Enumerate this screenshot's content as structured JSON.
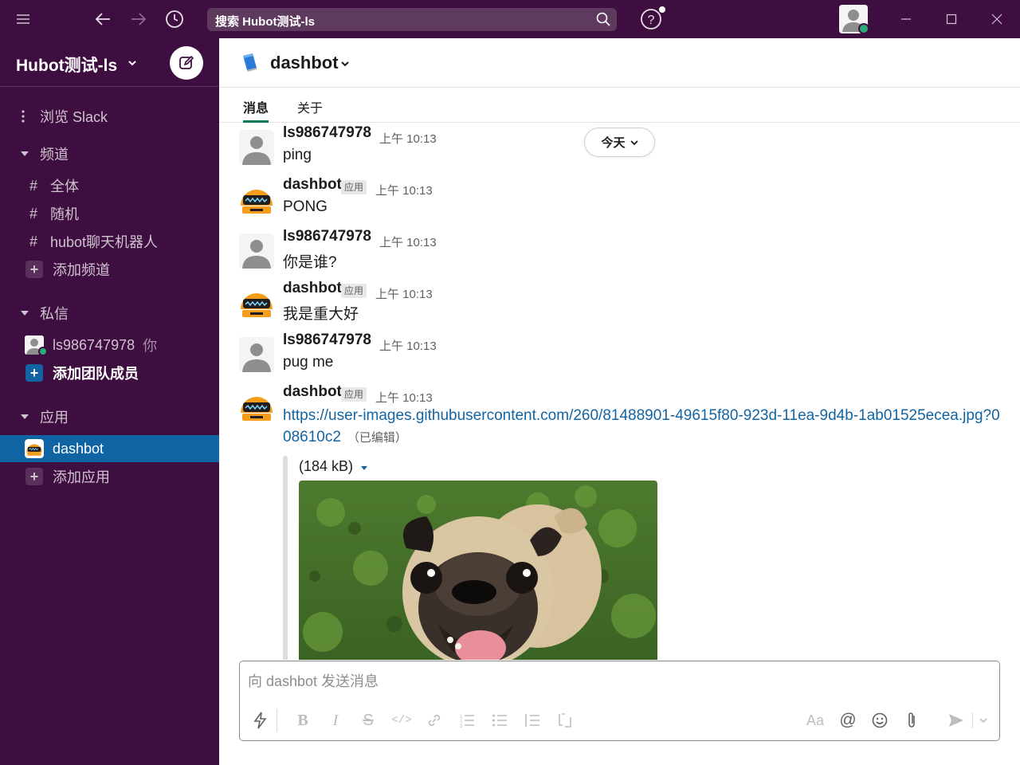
{
  "titlebar": {
    "search_text": "搜索 Hubot测试-ls"
  },
  "workspace": {
    "name": "Hubot测试-ls"
  },
  "sidebar": {
    "browse": "浏览 Slack",
    "channels_header": "频道",
    "channels": [
      "全体",
      "随机",
      "hubot聊天机器人"
    ],
    "add_channel": "添加频道",
    "dm_header": "私信",
    "dm_user": "ls986747978",
    "dm_you": "你",
    "add_members": "添加团队成员",
    "apps_header": "应用",
    "app_active": "dashbot",
    "add_app": "添加应用"
  },
  "channel": {
    "name": "dashbot",
    "tabs": [
      "消息",
      "关于"
    ]
  },
  "today_pill": "今天",
  "messages": [
    {
      "author": "ls986747978",
      "time": "上午 10:13",
      "text": "ping",
      "app": false
    },
    {
      "author": "dashbot",
      "badge": "应用",
      "time": "上午 10:13",
      "text": "PONG",
      "app": true
    },
    {
      "author": "ls986747978",
      "time": "上午 10:13",
      "text": "你是谁?",
      "app": false
    },
    {
      "author": "dashbot",
      "badge": "应用",
      "time": "上午 10:13",
      "text": "我是重大好",
      "app": true
    },
    {
      "author": "ls986747978",
      "time": "上午 10:13",
      "text": "pug me",
      "app": false
    },
    {
      "author": "dashbot",
      "badge": "应用",
      "time": "上午 10:13",
      "link": "https://user-images.githubusercontent.com/260/81488901-49615f80-923d-11ea-9d4b-1ab01525ecea.jpg?008610c2",
      "edited": "（已编辑）",
      "attachment_size": "(184 kB)",
      "app": true
    }
  ],
  "composer": {
    "placeholder": "向 dashbot 发送消息"
  },
  "colors": {
    "sidebar_bg": "#3f0e40",
    "active_item": "#1164a3",
    "link": "#1264a3",
    "tab_underline": "#007a5a",
    "presence": "#2bac76"
  }
}
